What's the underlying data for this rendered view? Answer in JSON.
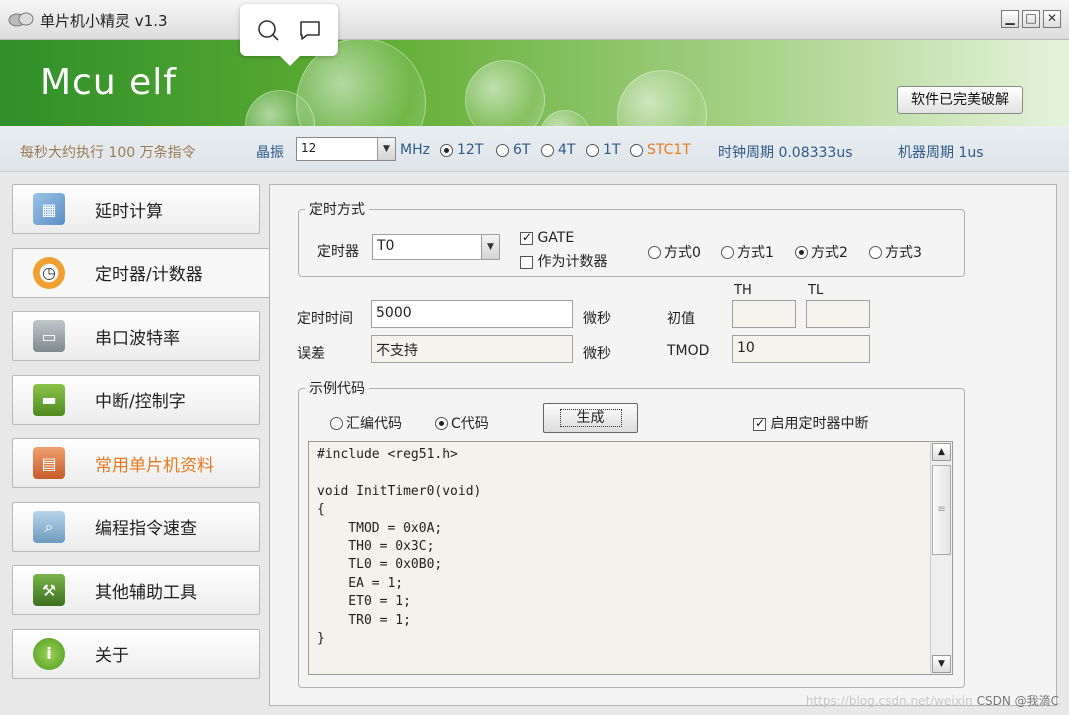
{
  "window": {
    "title": "单片机小精灵  v1.3"
  },
  "banner": {
    "logo": "Mcu elf",
    "crack_button": "软件已完美破解"
  },
  "info": {
    "exec_rate": "每秒大约执行 100 万条指令",
    "crystal_label": "晶振",
    "crystal_value": "12",
    "mhz": "MHz",
    "modes": [
      {
        "label": "12T",
        "selected": true
      },
      {
        "label": "6T",
        "selected": false
      },
      {
        "label": "4T",
        "selected": false
      },
      {
        "label": "1T",
        "selected": false
      },
      {
        "label": "STC1T",
        "selected": false
      }
    ],
    "clock_period": "时钟周期 0.08333us",
    "machine_period": "机器周期 1us"
  },
  "sidebar": {
    "items": [
      {
        "label": "延时计算",
        "icon": "calculator-icon"
      },
      {
        "label": "定时器/计数器",
        "icon": "alarm-clock-icon",
        "active": true
      },
      {
        "label": "串口波特率",
        "icon": "monitor-icon"
      },
      {
        "label": "中断/控制字",
        "icon": "chip-icon"
      },
      {
        "label": "常用单片机资料",
        "icon": "book-icon",
        "highlight": true
      },
      {
        "label": "编程指令速查",
        "icon": "magnifier-icon"
      },
      {
        "label": "其他辅助工具",
        "icon": "toolbox-icon"
      },
      {
        "label": "关于",
        "icon": "info-icon"
      }
    ]
  },
  "timer_mode": {
    "legend": "定时方式",
    "timer_label": "定时器",
    "timer_value": "T0",
    "gate_label": "GATE",
    "gate_checked": true,
    "counter_label": "作为计数器",
    "counter_checked": false,
    "modes": [
      {
        "label": "方式0",
        "selected": false
      },
      {
        "label": "方式1",
        "selected": false
      },
      {
        "label": "方式2",
        "selected": true
      },
      {
        "label": "方式3",
        "selected": false
      }
    ]
  },
  "timing": {
    "time_label": "定时时间",
    "time_value": "5000",
    "unit1": "微秒",
    "error_label": "误差",
    "error_value": "不支持",
    "unit2": "微秒",
    "init_label": "初值",
    "th_label": "TH",
    "tl_label": "TL",
    "th_value": "",
    "tl_value": "",
    "tmod_label": "TMOD",
    "tmod_value": "10"
  },
  "sample": {
    "legend": "示例代码",
    "asm_label": "汇编代码",
    "c_label": "C代码",
    "generate_button": "生成",
    "enable_int_label": "启用定时器中断",
    "enable_int_checked": true,
    "code": "#include <reg51.h>\n\nvoid InitTimer0(void)\n{\n    TMOD = 0x0A;\n    TH0 = 0x3C;\n    TL0 = 0x0B0;\n    EA = 1;\n    ET0 = 1;\n    TR0 = 1;\n}"
  },
  "watermark": {
    "url": "https://blog.csdn.net/weixin",
    "brand": "CSDN @我滴C"
  },
  "popup": {
    "icons": [
      "search-icon",
      "comment-icon"
    ]
  },
  "colors": {
    "banner_green": "#2f8f2a",
    "accent_orange": "#e87a1e",
    "info_blue": "#2d5a8a"
  }
}
